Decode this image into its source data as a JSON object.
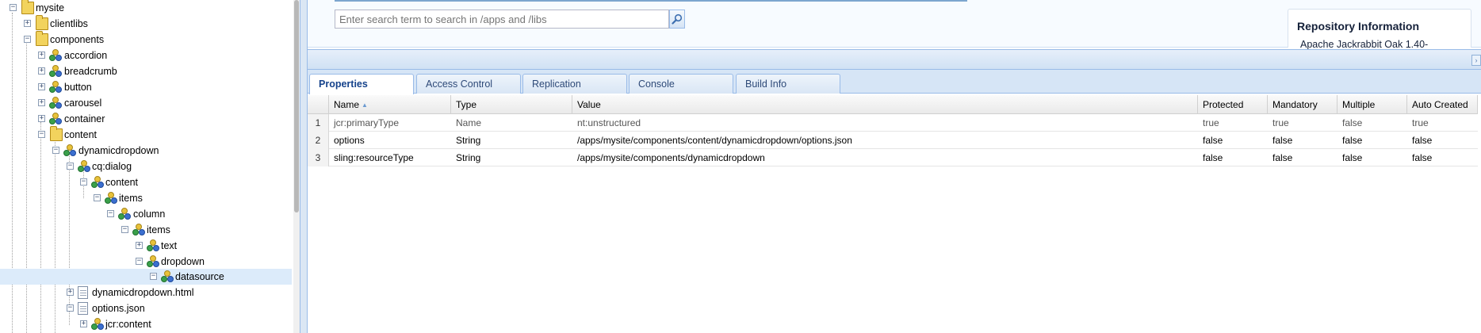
{
  "tree": {
    "nodes": [
      {
        "label": "mysite",
        "icon": "folder-icon",
        "toggle": "−"
      },
      {
        "label": "clientlibs",
        "icon": "folder-icon",
        "toggle": "+"
      },
      {
        "label": "components",
        "icon": "folder-icon",
        "toggle": "−"
      },
      {
        "label": "accordion",
        "icon": "node-icon",
        "toggle": "+"
      },
      {
        "label": "breadcrumb",
        "icon": "node-icon",
        "toggle": "+"
      },
      {
        "label": "button",
        "icon": "node-icon",
        "toggle": "+"
      },
      {
        "label": "carousel",
        "icon": "node-icon",
        "toggle": "+"
      },
      {
        "label": "container",
        "icon": "node-icon",
        "toggle": "+"
      },
      {
        "label": "content",
        "icon": "folder-icon",
        "toggle": "−"
      },
      {
        "label": "dynamicdropdown",
        "icon": "node-icon",
        "toggle": "−"
      },
      {
        "label": "cq:dialog",
        "icon": "node-icon",
        "toggle": "−"
      },
      {
        "label": "content",
        "icon": "node-icon",
        "toggle": "−"
      },
      {
        "label": "items",
        "icon": "node-icon",
        "toggle": "−"
      },
      {
        "label": "column",
        "icon": "node-icon",
        "toggle": "−"
      },
      {
        "label": "items",
        "icon": "node-icon",
        "toggle": "−"
      },
      {
        "label": "text",
        "icon": "node-icon",
        "toggle": "+"
      },
      {
        "label": "dropdown",
        "icon": "node-icon",
        "toggle": "−"
      },
      {
        "label": "datasource",
        "icon": "node-icon",
        "toggle": "−",
        "selected": true
      },
      {
        "label": "dynamicdropdown.html",
        "icon": "file-icon",
        "toggle": "+"
      },
      {
        "label": "options.json",
        "icon": "file-icon",
        "toggle": "−"
      },
      {
        "label": "jcr:content",
        "icon": "node-icon",
        "toggle": "+"
      }
    ]
  },
  "search": {
    "placeholder": "Enter search term to search in /apps and /libs"
  },
  "repository": {
    "title": "Repository Information",
    "text": "Apache Jackrabbit Oak 1.40-"
  },
  "tabs": [
    {
      "label": "Properties",
      "active": true
    },
    {
      "label": "Access Control",
      "active": false
    },
    {
      "label": "Replication",
      "active": false
    },
    {
      "label": "Console",
      "active": false
    },
    {
      "label": "Build Info",
      "active": false
    }
  ],
  "grid": {
    "columns": [
      "Name",
      "Type",
      "Value",
      "Protected",
      "Mandatory",
      "Multiple",
      "Auto Created"
    ],
    "rows": [
      {
        "num": "1",
        "name": "jcr:primaryType",
        "type": "Name",
        "value": "nt:unstructured",
        "protected": "true",
        "mandatory": "true",
        "multiple": "false",
        "auto_created": "true"
      },
      {
        "num": "2",
        "name": "options",
        "type": "String",
        "value": "/apps/mysite/components/content/dynamicdropdown/options.json",
        "protected": "false",
        "mandatory": "false",
        "multiple": "false",
        "auto_created": "false"
      },
      {
        "num": "3",
        "name": "sling:resourceType",
        "type": "String",
        "value": "/apps/mysite/components/dynamicdropdown",
        "protected": "false",
        "mandatory": "false",
        "multiple": "false",
        "auto_created": "false"
      }
    ]
  },
  "colors": {
    "selected_row": "#dcebfa",
    "panel_border": "#99bbe8",
    "tab_text": "#15428b"
  }
}
